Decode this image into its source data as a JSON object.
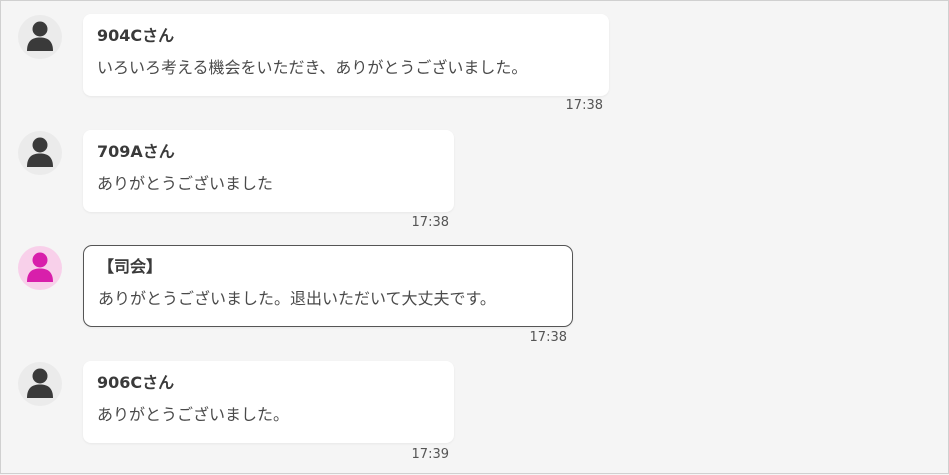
{
  "colors": {
    "background": "#f5f5f5",
    "bubble": "#ffffff",
    "host_avatar": "#d81fab",
    "user_avatar": "#3a3a3a"
  },
  "messages": [
    {
      "sender": "904Cさん",
      "text": "いろいろ考える機会をいただき、ありがとうございました。",
      "time": "17:38",
      "avatar_icon": "user-icon"
    },
    {
      "sender": "709Aさん",
      "text": "ありがとうございました",
      "time": "17:38",
      "avatar_icon": "user-icon"
    },
    {
      "sender": "【司会】",
      "text": "ありがとうございました。退出いただいて大丈夫です。",
      "time": "17:38",
      "avatar_icon": "host-user-icon"
    },
    {
      "sender": "906Cさん",
      "text": "ありがとうございました。",
      "time": "17:39",
      "avatar_icon": "user-icon"
    }
  ]
}
